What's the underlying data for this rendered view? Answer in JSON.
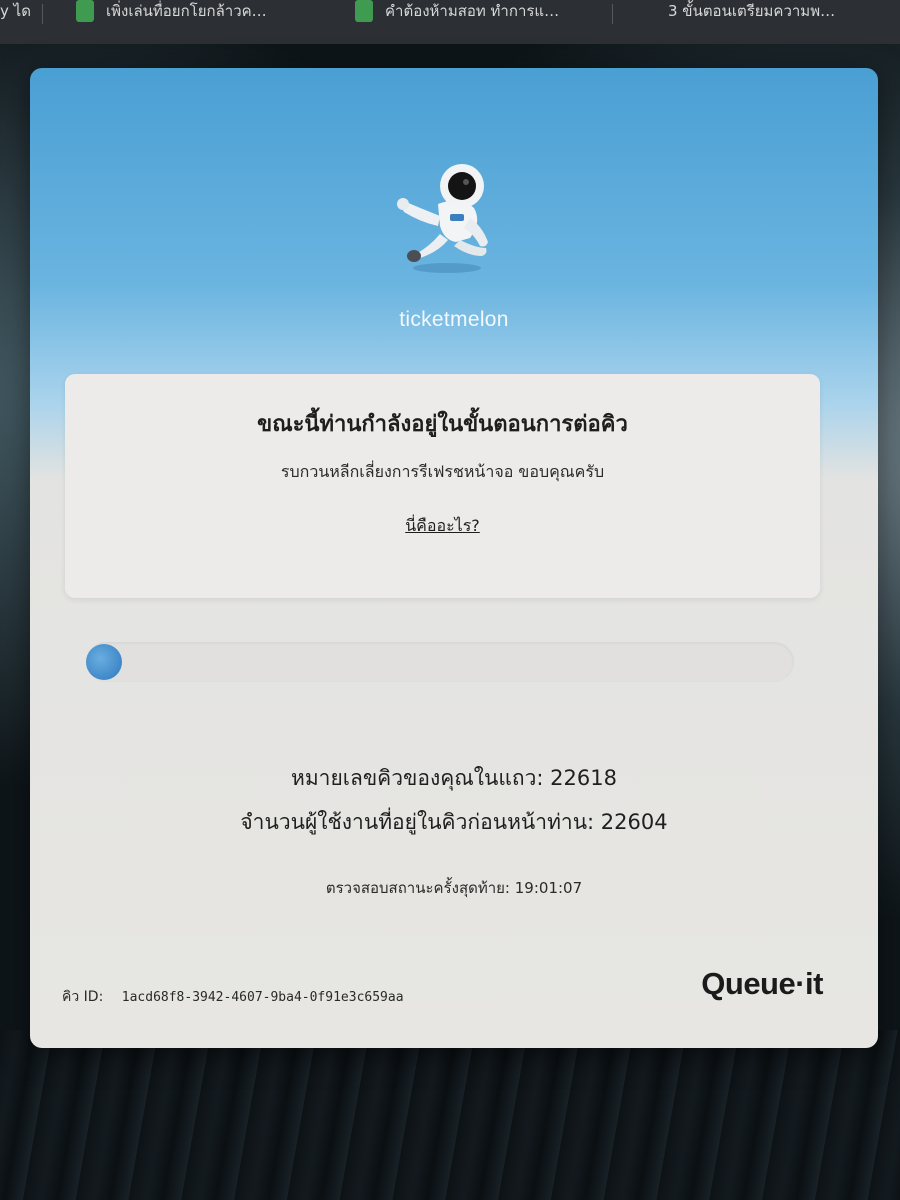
{
  "browser": {
    "tabs": [
      {
        "title": "y ได",
        "favicon_color": "#2c2f33"
      },
      {
        "title": "เพิ่งเล่นทื่อยกโยกล้าวค…",
        "favicon_color": "#3f9b4f"
      },
      {
        "title": "คำต้องห้ามสอท ทำการแ…",
        "favicon_color": "#3f9b4f"
      },
      {
        "title": "3 ขั้นตอนเตรียมความพ…",
        "favicon_color": "#2c2f33"
      }
    ]
  },
  "queue": {
    "brand": "ticketmelon",
    "headline": "ขณะนี้ท่านกำลังอยู่ในขั้นตอนการต่อคิว",
    "subline": "รบกวนหลีกเลี่ยงการรีเฟรชหน้าจอ ขอบคุณครับ",
    "what_link": "นี่คืออะไร?",
    "progress": 0.05,
    "queue_number_text": "หมายเลขคิวของคุณในแถว: 22618",
    "users_ahead_text": "จำนวนผู้ใช้งานที่อยู่ในคิวก่อนหน้าท่าน: 22604",
    "last_check_text": "ตรวจสอบสถานะครั้งสุดท้าย: 19:01:07",
    "queue_id_label": "คิว ID:",
    "queue_id_value": "1acd68f8-3942-4607-9ba4-0f91e3c659aa",
    "provider_logo": "Queue·it",
    "accent_color": "#3f88c8"
  }
}
